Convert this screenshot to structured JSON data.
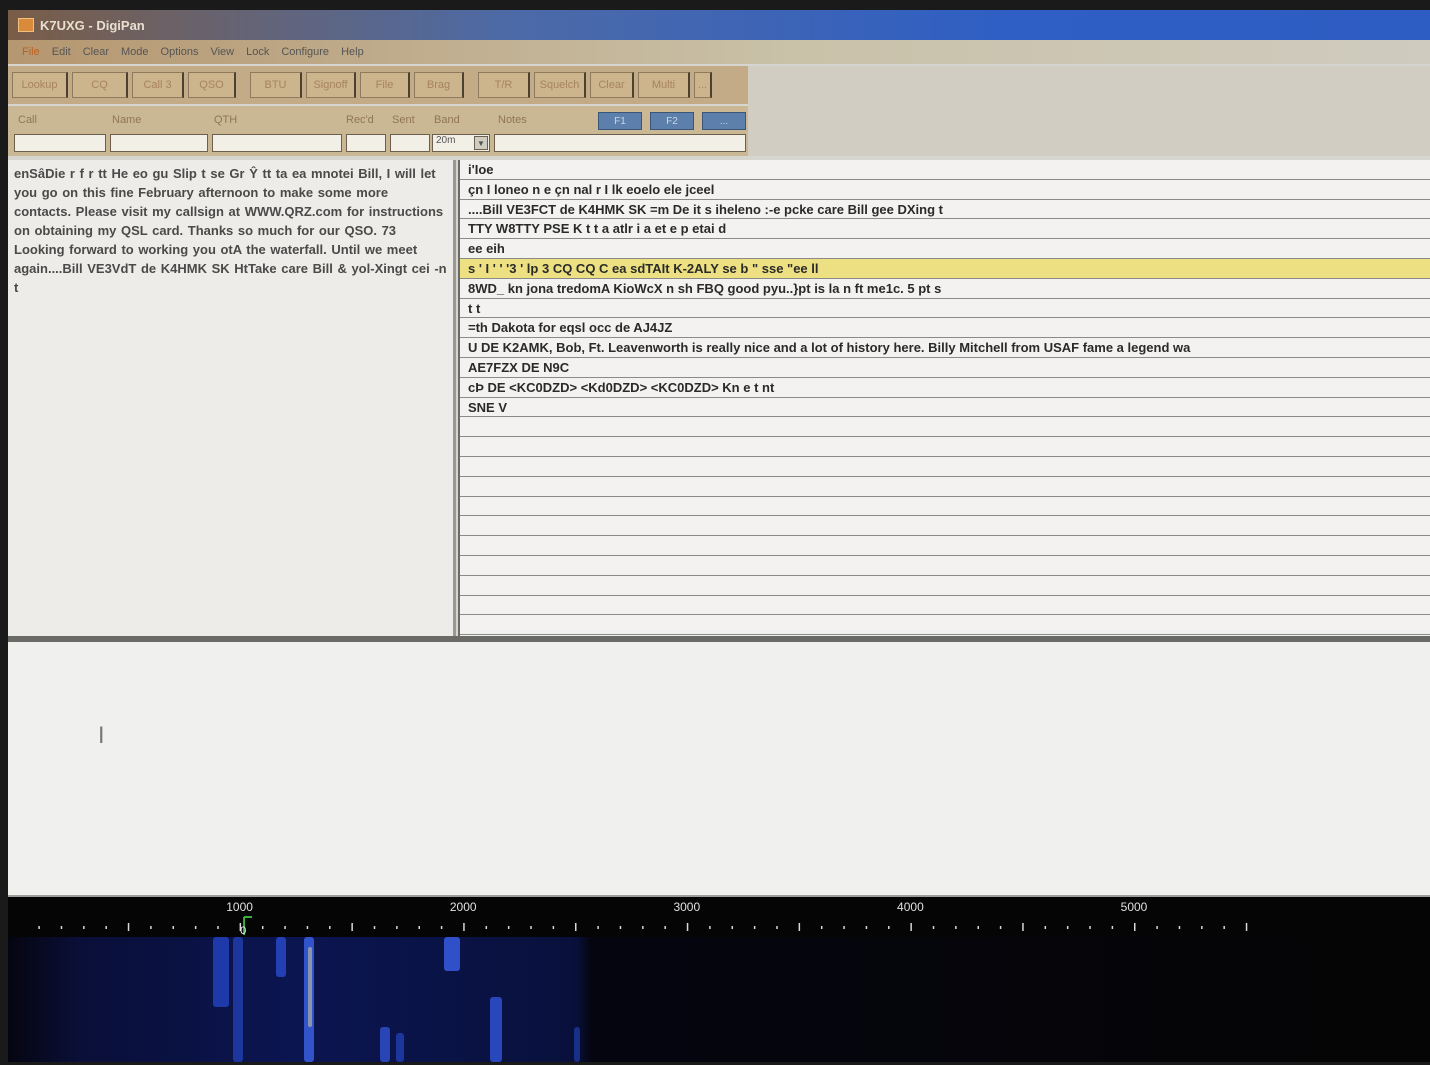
{
  "window": {
    "title": "K7UXG - DigiPan"
  },
  "menu": [
    "File",
    "Edit",
    "Clear",
    "Mode",
    "Options",
    "View",
    "Lock",
    "Configure",
    "Help"
  ],
  "toolbar": {
    "buttons": [
      "Lookup",
      "CQ",
      "Call 3",
      "QSO",
      "BTU",
      "Signoff",
      "File",
      "Brag",
      "T/R",
      "Squelch",
      "Clear",
      "Multi",
      "..."
    ]
  },
  "fields": {
    "call_label": "Call",
    "name_label": "Name",
    "qth_label": "QTH",
    "recd_label": "Rec'd",
    "sent_label": "Sent",
    "band_label": "Band",
    "notes_label": "Notes",
    "band_value": "20m",
    "mini_buttons": [
      "F1",
      "F2",
      "..."
    ]
  },
  "rx_text": "enSâDie r f r tt He  eo  gu Slip   t  se   Gr    Ŷ tt ta ea mnotei  Bill, I will let you go on this fine February afternoon to make some more contacts. Please visit my callsign at WWW.QRZ.com for instructions on obtaining my QSL card. Thanks so much for our QSO. 73  Looking forward to working you otA      the waterfall. Until we meet again....Bill VE3VdT de K4HMK SK    HtTake care Bill & yol-Xingt cei  -n t",
  "channels": [
    "i'Ioe",
    "çn I loneo n e çn nal r I lk eoelo ele jceel",
    "....Bill VE3FCT de K4HMK SK =m De it s ihelenо :-e pcke care Bill  gee DXing t",
    "TTY W8TTY PSE K t t a atlr i a et e p etai d",
    " ee eih",
    "s ' I ' ' '3 ' lp 3 CQ CQ C ea sdTAIt K-2ALY se b \" sse \"ee ll",
    "8WD_ kn jona tredomA KioWcX n sh FBQ good pyu..}pt is la n ft me1c. 5 pt s",
    "t t",
    "=th Dakota for eqsl occ de AJ4JZ",
    "U DE K2AMK, Bob, Ft. Leavenworth is really nice and a lot of history here. Billy Mitchell from USAF fame a legend wa",
    "AE7FZX DE N9C",
    "cÞ DE <KC0DZD> <Kd0DZD> <KC0DZD> Kn e t nt",
    " SNE V",
    "",
    "",
    "",
    "",
    "",
    "",
    "",
    "",
    "",
    "",
    ""
  ],
  "waterfall": {
    "scale_labels": [
      "1000",
      "2000",
      "3000",
      "4000",
      "5000"
    ],
    "marker_label": "0"
  },
  "colors": {
    "highlight_row": "#ece082",
    "waterfall_signal": "#2a4fd6",
    "marker": "#3ab040"
  }
}
